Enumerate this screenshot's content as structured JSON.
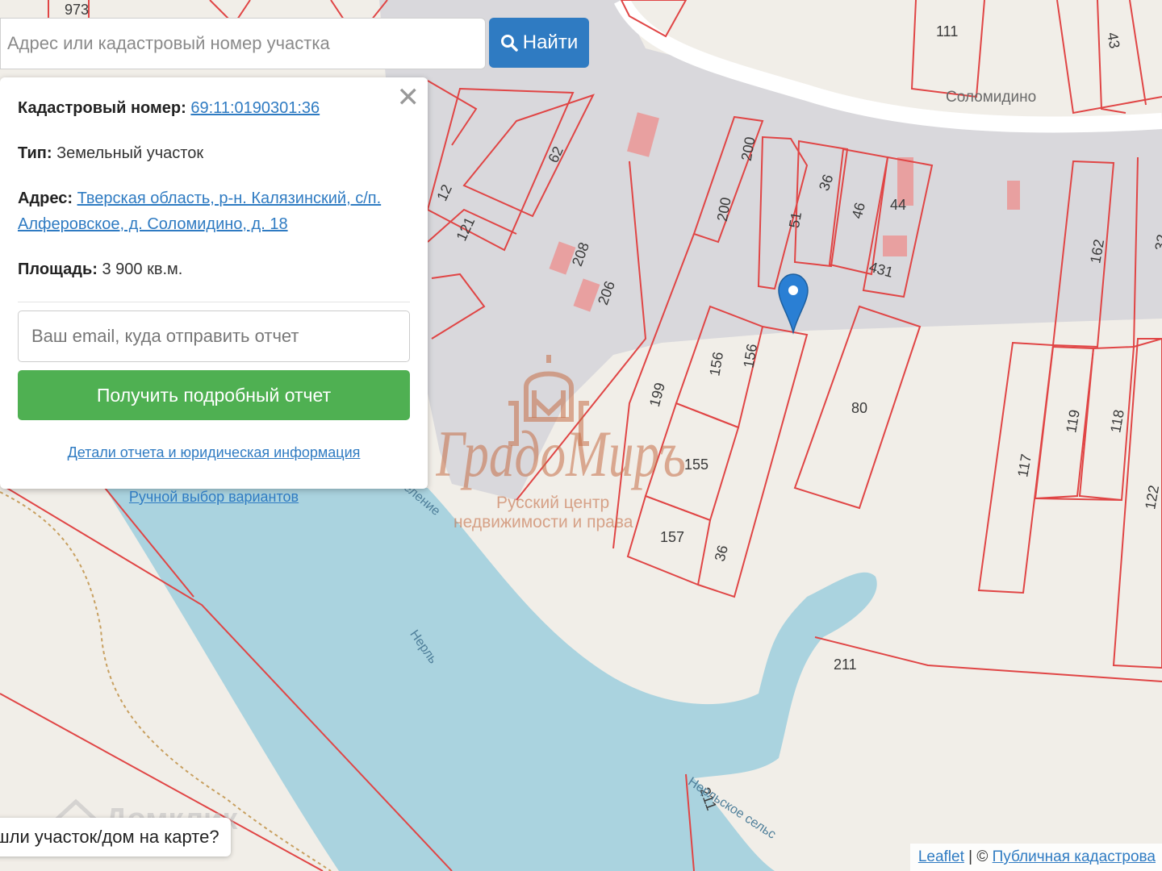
{
  "search": {
    "placeholder": "Адрес или кадастровый номер участка",
    "button_label": "Найти",
    "button_icon": "search-icon"
  },
  "popup": {
    "close_icon": "close-icon",
    "cadastral_label": "Кадастровый номер:",
    "cadastral_value": "69:11:0190301:36",
    "type_label": "Тип:",
    "type_value": "Земельный участок",
    "address_label": "Адрес:",
    "address_value": "Тверская область, р-н. Калязинский, с/п. Алферовское, д. Соломидино, д. 18",
    "area_label": "Площадь:",
    "area_value": "3 900 кв.м.",
    "email_placeholder": "Ваш email, куда отправить отчет",
    "report_button": "Получить подробный отчет",
    "details_link": "Детали отчета и юридическая информация",
    "manual_link": "Ручной выбор вариантов"
  },
  "map": {
    "place_name": "Соломидино",
    "river_name": "Нерль",
    "river_name_2": "Нерльское сельс",
    "settlement_partial": "еление",
    "marker_icon": "map-marker-icon",
    "parcel_labels": [
      "973",
      "111",
      "43",
      "12",
      "121",
      "62",
      "200",
      "200",
      "208",
      "206",
      "51",
      "36",
      "46",
      "44",
      "431",
      "162",
      "32",
      "199",
      "156",
      "156",
      "155",
      "157",
      "36",
      "80",
      "117",
      "119",
      "118",
      "122",
      "211",
      "211"
    ],
    "colors": {
      "parcel_stroke": "#e04545",
      "water": "#aad3df",
      "grey_zone": "#d9d8dc",
      "land": "#f1eee8",
      "building": "#e8a0a0",
      "marker": "#2a7fd4"
    }
  },
  "watermark": {
    "brand": "ГрадоМиръ",
    "subtitle_1": "Русский центр",
    "subtitle_2": "недвижимости и права",
    "domclick": "Домклик"
  },
  "attribution": {
    "leaflet": "Leaflet",
    "separator": " | © ",
    "source": "Публичная кадастрова"
  },
  "help": {
    "text": "шли участок/дом на карте?"
  }
}
